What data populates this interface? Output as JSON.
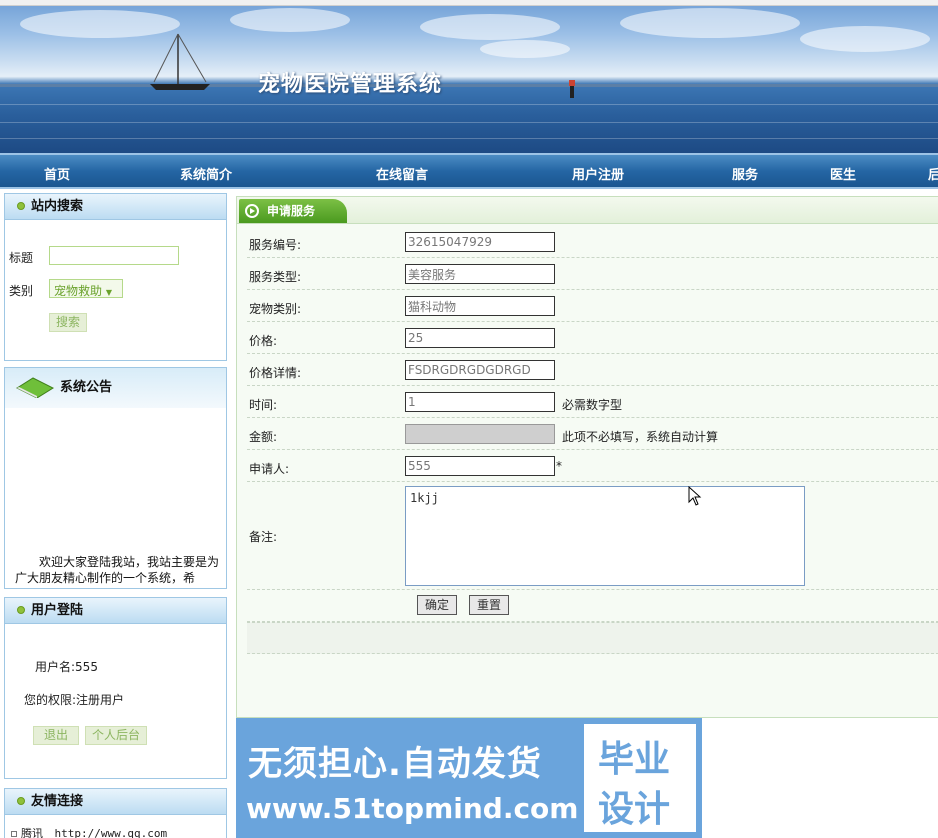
{
  "header": {
    "title": "宠物医院管理系统"
  },
  "nav": {
    "items": [
      "首页",
      "系统简介",
      "在线留言",
      "用户注册",
      "服务",
      "医生",
      "后"
    ]
  },
  "sidebar": {
    "search": {
      "title": "站内搜索",
      "title_label": "标题",
      "title_value": "",
      "category_label": "类别",
      "category_value": "宠物救助",
      "search_button": "搜索"
    },
    "notice": {
      "title": "系统公告",
      "text": "欢迎大家登陆我站，我站主要是为广大朋友精心制作的一个系统，希"
    },
    "login": {
      "title": "用户登陆",
      "username_text": "用户名:555",
      "permission_text": "您的权限:注册用户",
      "logout_button": "退出",
      "backend_button": "个人后台"
    },
    "links": {
      "title": "友情连接",
      "items": [
        {
          "name": "腾讯",
          "url": "http://www.qq.com"
        }
      ]
    }
  },
  "main": {
    "tab_title": "申请服务",
    "fields": {
      "service_no": {
        "label": "服务编号:",
        "value": "32615047929"
      },
      "service_type": {
        "label": "服务类型:",
        "value": "美容服务"
      },
      "pet_type": {
        "label": "宠物类别:",
        "value": "猫科动物"
      },
      "price": {
        "label": "价格:",
        "value": "25"
      },
      "price_detail": {
        "label": "价格详情:",
        "value": "FSDRGDRGDGDRGD"
      },
      "time": {
        "label": "时间:",
        "value": "1",
        "hint": "必需数字型"
      },
      "amount": {
        "label": "金额:",
        "value": "",
        "hint": "此项不必填写，系统自动计算"
      },
      "applicant": {
        "label": "申请人:",
        "value": "555",
        "required_mark": "*"
      },
      "remarks": {
        "label": "备注:",
        "value": "1kjj"
      }
    },
    "confirm_button": "确定",
    "reset_button": "重置"
  },
  "watermark": {
    "line1": "无须担心.自动发货",
    "line2": "www.51topmind.com",
    "box_line1": "毕业",
    "box_line2": "设计"
  }
}
